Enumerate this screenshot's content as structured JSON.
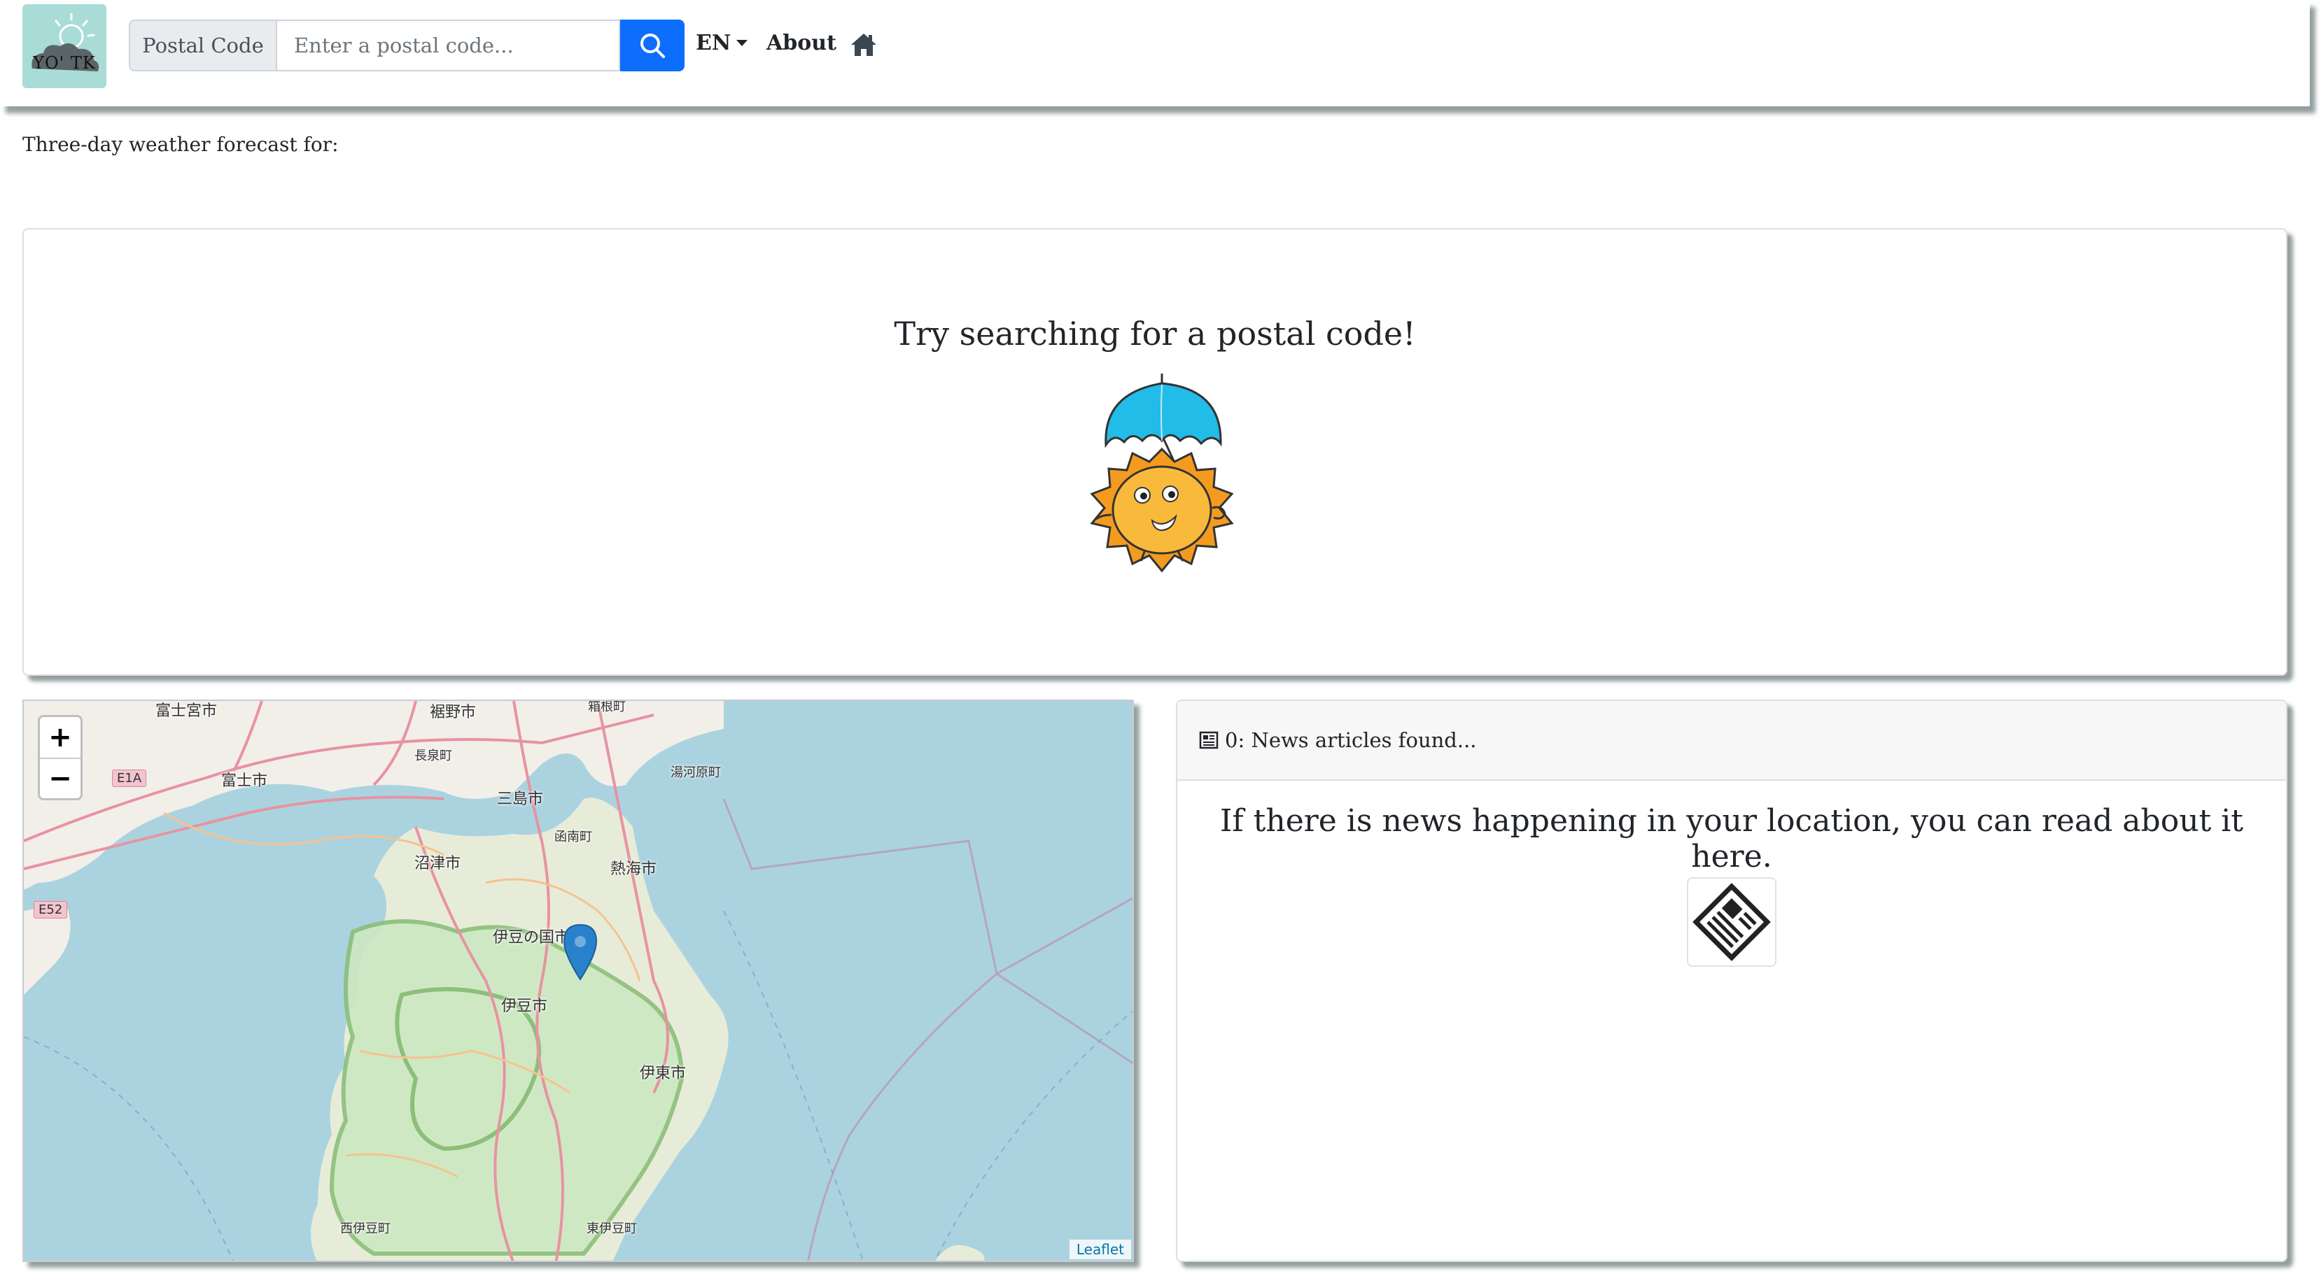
{
  "navbar": {
    "logo_text": "YO' TK",
    "search_label": "Postal Code",
    "search_placeholder": "Enter a postal code...",
    "language": "EN",
    "about": "About"
  },
  "subtitle": "Three-day weather forecast for:",
  "hero": {
    "title": "Try searching for a postal code!"
  },
  "map": {
    "zoom_in": "+",
    "zoom_out": "−",
    "attribution": "Leaflet",
    "labels": [
      "富士宮市",
      "裾野市",
      "箱根町",
      "長泉町",
      "富士市",
      "湯河原町",
      "三島市",
      "函南町",
      "沼津市",
      "熱海市",
      "伊豆の国市",
      "伊豆市",
      "伊東市",
      "西伊豆町",
      "東伊豆町"
    ],
    "road_shields": [
      "E1A",
      "E52"
    ]
  },
  "news": {
    "count_label": "0: News articles found...",
    "message": "If there is news happening in your location, you can read about it here."
  },
  "colors": {
    "primary": "#0d6efd",
    "logo_bg": "#a9dcd6",
    "water": "#aad3df",
    "land": "#f2efe9",
    "park": "#cde8c2",
    "sun_outer": "#f49b1f",
    "sun_inner": "#f9b93b",
    "umbrella": "#22bce8",
    "marker": "#2a81cb"
  }
}
